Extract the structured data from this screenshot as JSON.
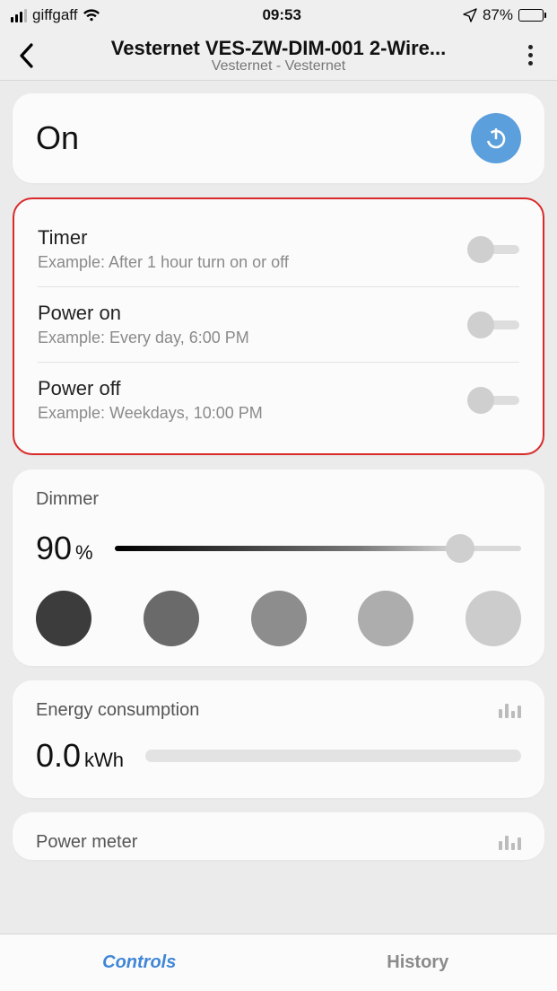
{
  "status": {
    "carrier": "giffgaff",
    "time": "09:53",
    "battery_pct": "87%"
  },
  "nav": {
    "title": "Vesternet VES-ZW-DIM-001 2-Wire...",
    "subtitle": "Vesternet - Vesternet"
  },
  "on_card": {
    "label": "On"
  },
  "timers": [
    {
      "title": "Timer",
      "subtitle": "Example: After 1 hour turn on or off"
    },
    {
      "title": "Power on",
      "subtitle": "Example: Every day, 6:00 PM"
    },
    {
      "title": "Power off",
      "subtitle": "Example: Weekdays, 10:00 PM"
    }
  ],
  "dimmer": {
    "title": "Dimmer",
    "value": "90",
    "value_suffix": "%",
    "swatches": [
      "#3c3c3c",
      "#6a6a6a",
      "#8d8d8d",
      "#adadad",
      "#cccccc"
    ]
  },
  "energy": {
    "title": "Energy consumption",
    "value": "0.0",
    "unit": "kWh"
  },
  "power_meter": {
    "title": "Power meter"
  },
  "tabs": {
    "controls": "Controls",
    "history": "History"
  }
}
